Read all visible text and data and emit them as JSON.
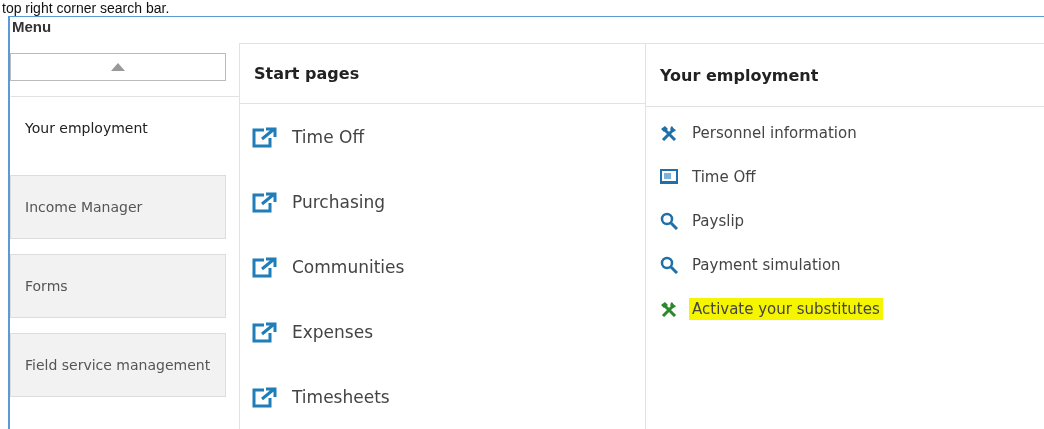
{
  "caption": "top right corner search bar.",
  "menu": {
    "title": "Menu",
    "tabs": [
      {
        "label": "Your employment",
        "selected": true
      },
      {
        "label": "Income Manager",
        "selected": false
      },
      {
        "label": "Forms",
        "selected": false
      },
      {
        "label": "Field service management",
        "selected": false
      }
    ]
  },
  "start_pages": {
    "title": "Start pages",
    "items": [
      "Time Off",
      "Purchasing",
      "Communities",
      "Expenses",
      "Timesheets"
    ]
  },
  "employment": {
    "title": "Your employment",
    "items": [
      {
        "label": "Personnel information",
        "kind": "tools",
        "highlighted": false
      },
      {
        "label": "Time Off",
        "kind": "form",
        "highlighted": false
      },
      {
        "label": "Payslip",
        "kind": "search",
        "highlighted": false
      },
      {
        "label": "Payment simulation",
        "kind": "search",
        "highlighted": false
      },
      {
        "label": "Activate your substitutes",
        "kind": "tools",
        "highlighted": true
      }
    ]
  }
}
